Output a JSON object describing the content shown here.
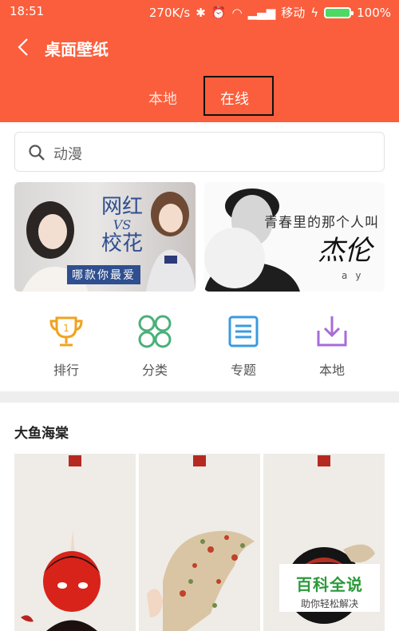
{
  "status": {
    "time": "18:51",
    "speed": "270K/s",
    "carrier": "移动",
    "battery": "100%"
  },
  "nav": {
    "title": "桌面壁纸"
  },
  "tabs": [
    {
      "label": "本地"
    },
    {
      "label": "在线"
    }
  ],
  "search": {
    "placeholder": "动漫"
  },
  "banners": [
    {
      "title_top": "网红",
      "vs": "VS",
      "title_bottom": "校花",
      "subtitle": "哪款你最爱"
    },
    {
      "title": "青春里的那个人叫",
      "signature": "杰伦",
      "subtitle": "ay"
    }
  ],
  "categories": [
    {
      "label": "排行",
      "icon": "trophy-icon",
      "color": "#f0a31d"
    },
    {
      "label": "分类",
      "icon": "grid-circles-icon",
      "color": "#4bb07a"
    },
    {
      "label": "专题",
      "icon": "document-list-icon",
      "color": "#3a9be0"
    },
    {
      "label": "本地",
      "icon": "download-tray-icon",
      "color": "#a76bd8"
    }
  ],
  "section": {
    "title": "大鱼海棠"
  },
  "watermark": {
    "main": "百科全说",
    "sub": "助你轻松解决"
  },
  "colors": {
    "accent": "#fa5e3c",
    "text_muted": "#555555"
  }
}
